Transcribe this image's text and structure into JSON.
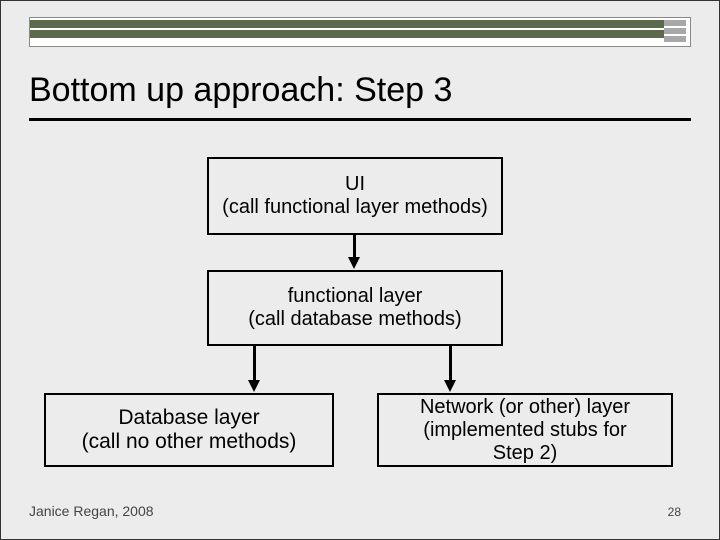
{
  "title": "Bottom up approach:  Step 3",
  "boxes": {
    "ui": {
      "line1": "UI",
      "line2": "(call functional layer methods)"
    },
    "func": {
      "line1": "functional layer",
      "line2": "(call database methods)"
    },
    "db": {
      "line1": "Database layer",
      "line2": "(call no other methods)"
    },
    "net": {
      "line1": "Network (or other)  layer",
      "line2": "(implemented stubs for",
      "line3": "Step 2)"
    }
  },
  "footer": {
    "author": "Janice Regan, 2008",
    "page": "28"
  },
  "chart_data": {
    "type": "diagram",
    "nodes": [
      {
        "id": "ui",
        "label": "UI (call functional layer methods)"
      },
      {
        "id": "func",
        "label": "functional layer (call database methods)"
      },
      {
        "id": "db",
        "label": "Database layer (call no other methods)"
      },
      {
        "id": "net",
        "label": "Network (or other) layer (implemented stubs for Step 2)"
      }
    ],
    "edges": [
      {
        "from": "ui",
        "to": "func"
      },
      {
        "from": "func",
        "to": "db"
      },
      {
        "from": "func",
        "to": "net"
      }
    ],
    "title": "Bottom up approach: Step 3"
  }
}
